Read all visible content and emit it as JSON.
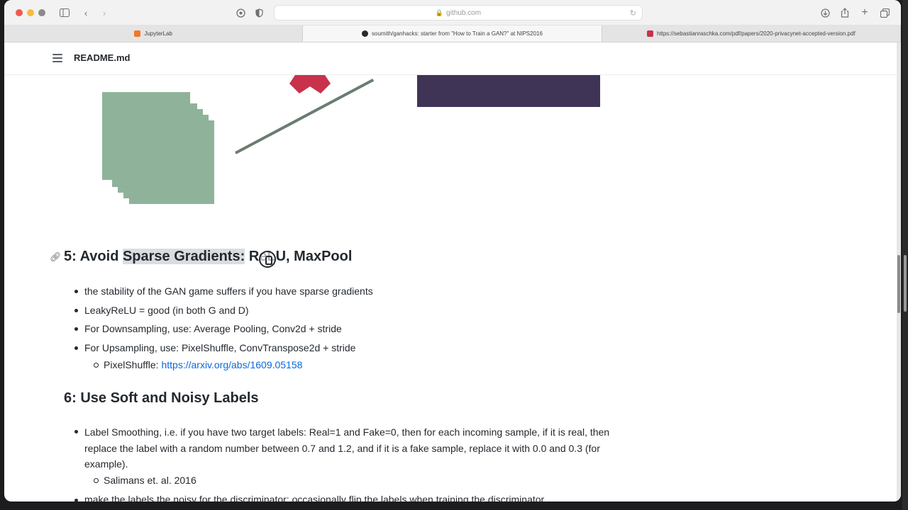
{
  "browser": {
    "url": "github.com",
    "tabs": [
      {
        "label": "JupyterLab",
        "active": false
      },
      {
        "label": "soumith/ganhacks: starter from \"How to Train a GAN?\" at NIPS2016",
        "active": true
      },
      {
        "label": "https://sebastianraschka.com/pdf/papers/2020-privacynet-accepted-version.pdf",
        "active": false
      }
    ]
  },
  "readme": {
    "title": "README.md"
  },
  "section5": {
    "heading_prefix": "5: Avoid ",
    "heading_highlight": "Sparse Gradients:",
    "heading_suffix": " ReLU, MaxPool",
    "items": [
      "the stability of the GAN game suffers if you have sparse gradients",
      "LeakyReLU = good (in both G and D)",
      "For Downsampling, use: Average Pooling, Conv2d + stride",
      "For Upsampling, use: PixelShuffle, ConvTranspose2d + stride"
    ],
    "sub_label": "PixelShuffle: ",
    "sub_link": "https://arxiv.org/abs/1609.05158"
  },
  "section6": {
    "heading": "6: Use Soft and Noisy Labels",
    "item1": "Label Smoothing, i.e. if you have two target labels: Real=1 and Fake=0, then for each incoming sample, if it is real, then replace the label with a random number between 0.7 and 1.2, and if it is a fake sample, replace it with 0.0 and 0.3 (for example).",
    "item1_sub": "Salimans et. al. 2016",
    "item2_cut": "make the labels the noisy for the discriminator: occasionally flip the labels when training the discriminator"
  },
  "colors": {
    "illustration_green": "#8fb39a",
    "illustration_red": "#c8324a",
    "illustration_purple": "#3f3356",
    "link": "#0969da"
  }
}
